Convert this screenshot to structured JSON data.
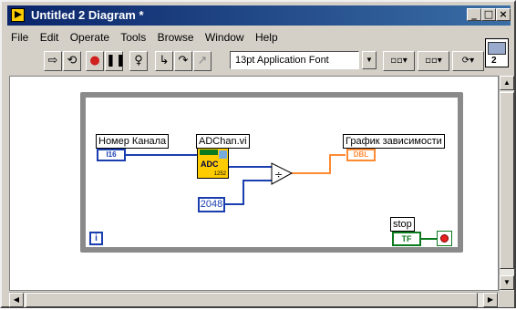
{
  "window": {
    "title": "Untitled 2 Diagram *",
    "controls": {
      "minimize": "_",
      "maximize": "□",
      "close": "×"
    }
  },
  "menu": [
    "File",
    "Edit",
    "Operate",
    "Tools",
    "Browse",
    "Window",
    "Help"
  ],
  "toolbar": {
    "buttons": [
      "run-arrow-icon",
      "run-continuous-icon",
      "abort-icon",
      "pause-icon",
      "highlight-execution-icon",
      "step-into-icon",
      "step-over-icon",
      "step-out-icon"
    ],
    "font": "13pt Application Font",
    "align_label": "▫▫▾",
    "distribute_label": "▫▫▾",
    "reorder_label": "⟳▾"
  },
  "context_icon": {
    "number": "2"
  },
  "diagram": {
    "channel_label": "Номер Канала",
    "channel_type": "I16",
    "subvi_label": "ADChan.vi",
    "subvi_icon_text": "ADC",
    "subvi_icon_number": "1252",
    "constant_value": "2048",
    "graph_label": "График зависимости",
    "graph_type": "DBL",
    "stop_label": "stop",
    "stop_type": "TF",
    "iteration_symbol": "i",
    "divide_symbol": "÷"
  },
  "colors": {
    "titlebar": "#0a246a",
    "int_wire": "#1a3eaf",
    "dbl_wire": "#ff8a33",
    "bool_wire": "#0b7a1e",
    "loop_border": "#8a8a8a"
  }
}
